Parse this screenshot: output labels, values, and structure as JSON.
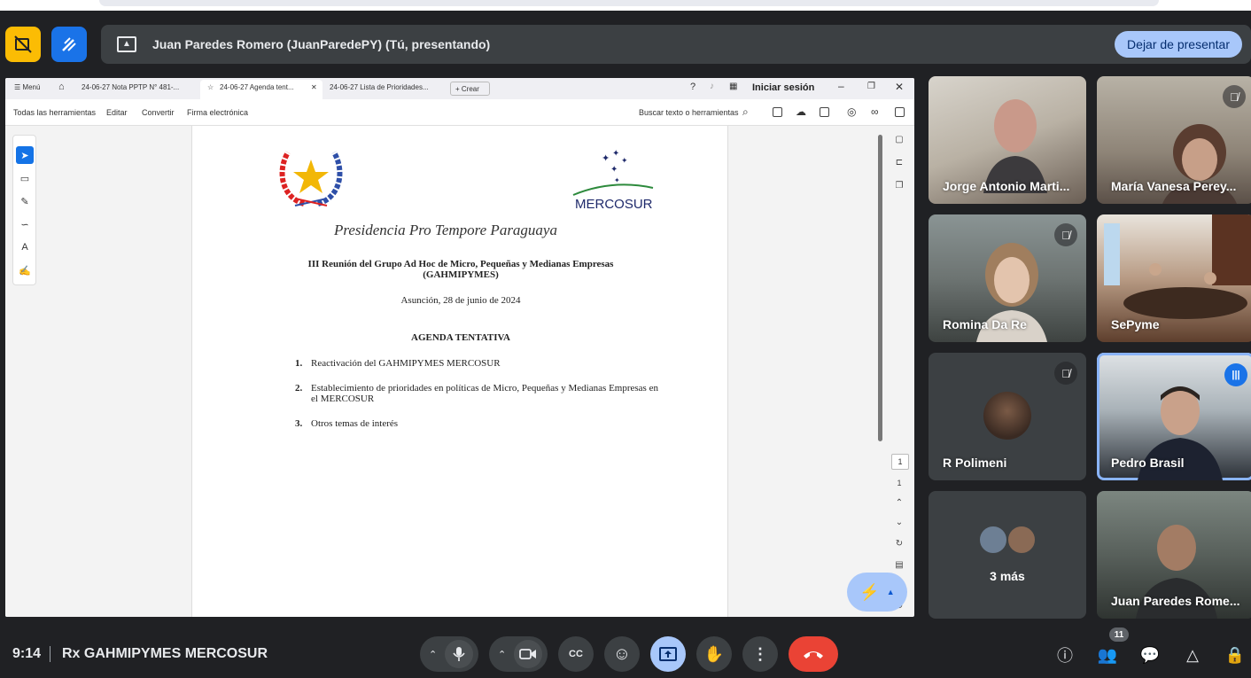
{
  "share_bar": {
    "presenter_text": "Juan Paredes Romero (JuanParedePY) (Tú, presentando)",
    "stop_label": "Dejar de presentar"
  },
  "reader": {
    "menu_label": "Menú",
    "tabs": [
      "24-06-27 Nota PPTP N° 481-...",
      "24-06-27 Agenda tent...",
      "24-06-27 Lista de Prioridades..."
    ],
    "new_tab_label": "Crear",
    "signin_label": "Iniciar sesión",
    "tools": [
      "Todas las herramientas",
      "Editar",
      "Convertir",
      "Firma electrónica"
    ],
    "search_label": "Buscar texto o herramientas",
    "page_current": "1",
    "page_total": "1"
  },
  "document": {
    "logo_text": "MERCOSUR",
    "header_script": "Presidencia Pro Tempore Paraguaya",
    "title_line1": "III Reunión del Grupo Ad Hoc de Micro, Pequeñas y Medianas Empresas",
    "title_line2": "(GAHMIPYMES)",
    "date": "Asunción, 28 de junio de 2024",
    "agenda_heading": "AGENDA TENTATIVA",
    "items": [
      {
        "num": "1.",
        "text": "Reactivación del GAHMIPYMES MERCOSUR"
      },
      {
        "num": "2.",
        "text": "Establecimiento de prioridades en políticas de Micro, Pequeñas y Medianas Empresas en el MERCOSUR"
      },
      {
        "num": "3.",
        "text": "Otros temas de interés"
      }
    ]
  },
  "participants": [
    {
      "name": "Jorge Antonio Marti...",
      "muted": false
    },
    {
      "name": "María Vanesa Perey...",
      "muted": true
    },
    {
      "name": "Romina Da Re",
      "muted": true
    },
    {
      "name": "SePyme",
      "muted": false
    },
    {
      "name": "R Polimeni",
      "muted": true
    },
    {
      "name": "Pedro Brasil",
      "muted": false,
      "speaking": true
    },
    {
      "name": "3 más",
      "muted": false
    },
    {
      "name": "Juan Paredes Rome...",
      "muted": false
    }
  ],
  "footer": {
    "time": "9:14",
    "meeting_name": "Rx GAHMIPYMES MERCOSUR",
    "people_count": "11"
  }
}
